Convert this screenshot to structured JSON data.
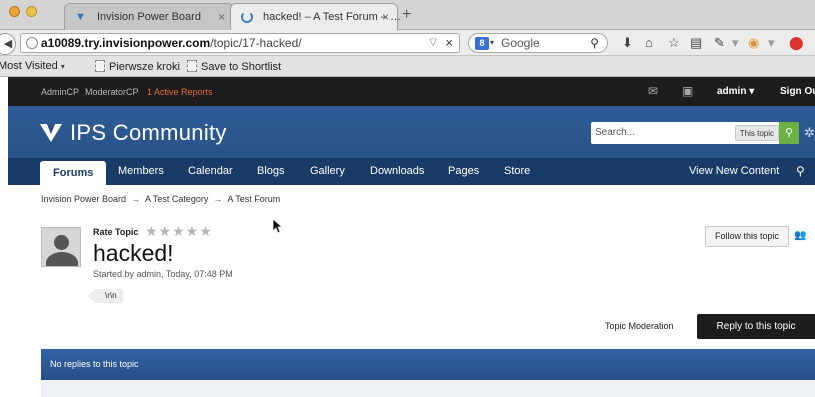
{
  "browser": {
    "tabs": [
      {
        "title": "Invision Power Board",
        "close": "×"
      },
      {
        "title": "hacked! – A Test Forum – …",
        "close": "×"
      }
    ],
    "new_tab": "+",
    "url_host": "a10089.try.invisionpower.com",
    "url_path": "/topic/17-hacked/",
    "url_clear": "×",
    "search_placeholder": "Google",
    "bookmarks": [
      {
        "label": "Most Visited"
      },
      {
        "label": "Pierwsze kroki"
      },
      {
        "label": "Save to Shortlist"
      }
    ]
  },
  "userbar": {
    "admincp": "AdminCP",
    "modcp": "ModeratorCP",
    "reports": "1 Active Reports",
    "username": "admin ▾",
    "signout": "Sign Ou"
  },
  "header": {
    "site_name": "IPS Community",
    "search_placeholder": "Search...",
    "search_scope": "This topic",
    "search_go": "Q"
  },
  "nav": {
    "items": [
      "Forums",
      "Members",
      "Calendar",
      "Blogs",
      "Gallery",
      "Downloads",
      "Pages",
      "Store"
    ],
    "view_new": "View New Content"
  },
  "breadcrumb": [
    "Invision Power Board",
    "A Test Category",
    "A Test Forum"
  ],
  "breadcrumb_sep": "→",
  "topic": {
    "rate_label": "Rate Topic",
    "stars": "★★★★★",
    "title": "hacked!",
    "started_by": "Started by admin, Today, 07:48 PM",
    "tag": "\\r\\n"
  },
  "actions": {
    "follow": "Follow this topic",
    "moderation": "Topic Moderation",
    "reply": "Reply to this topic"
  },
  "replies_bar": "No replies to this topic",
  "colors": {
    "header_blue": "#2a5188",
    "nav_blue": "#193b67",
    "reports_orange": "#e36a36",
    "search_green": "#6bb141"
  }
}
